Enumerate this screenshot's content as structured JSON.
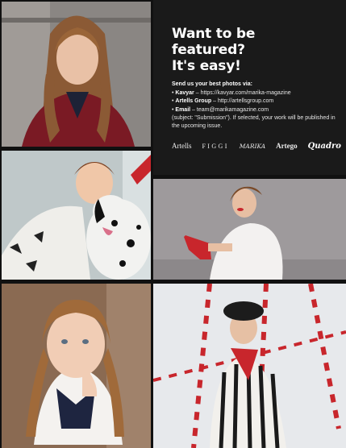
{
  "headline": [
    "Want to be",
    "featured?",
    "It's easy!"
  ],
  "intro": "Send us your best photos via:",
  "channels": [
    {
      "name": "Kavyar",
      "detail": "https://kavyar.com/marika-magazine"
    },
    {
      "name": "Artells Group",
      "detail": "http://artellsgroup.com"
    },
    {
      "name": "Email",
      "detail": "team@marikamagazine.com"
    }
  ],
  "note": "(subject: \"Submission\"). If selected, your work will be published in the upcoming issue.",
  "logos": [
    "Artells",
    "FIGGI",
    "MARIKA",
    "Artego",
    "Quadro"
  ],
  "photos": [
    {
      "subject": "portrait-girl-long-hair-red-velvet-jacket"
    },
    {
      "subject": "girl-hugging-dalmatian-dog"
    },
    {
      "subject": "girl-white-dress-red-heels"
    },
    {
      "subject": "girl-braids-white-blouse-chin-on-hand"
    },
    {
      "subject": "girl-black-hat-striped-jacket-red-white-poles"
    }
  ],
  "colors": {
    "background": "#111111",
    "panel": "#1a1a1a",
    "text": "#ffffff",
    "accent_red": "#c8262c"
  }
}
